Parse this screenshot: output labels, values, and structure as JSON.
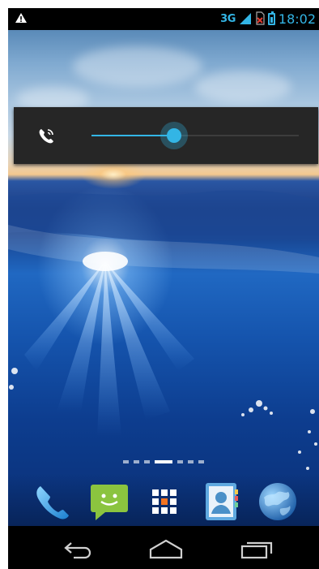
{
  "status_bar": {
    "left_icon": "warning-icon",
    "network_label": "3G",
    "signal_icon": "signal-bars-icon",
    "sim_icon": "no-sim-icon",
    "battery_icon": "battery-charging-icon",
    "time": "18:02"
  },
  "volume_panel": {
    "icon": "phone-ringer-icon",
    "level": 0.4,
    "accent_color": "#33b5e5"
  },
  "home": {
    "page_count": 7,
    "current_page_index": 3
  },
  "dock": {
    "items": [
      {
        "name": "phone",
        "icon": "phone-icon"
      },
      {
        "name": "messaging",
        "icon": "messaging-icon"
      },
      {
        "name": "all-apps",
        "icon": "app-drawer-icon"
      },
      {
        "name": "contacts",
        "icon": "contacts-icon"
      },
      {
        "name": "browser",
        "icon": "globe-icon"
      }
    ]
  },
  "nav_bar": {
    "back_icon": "back-icon",
    "home_icon": "home-icon",
    "recents_icon": "recent-apps-icon"
  }
}
